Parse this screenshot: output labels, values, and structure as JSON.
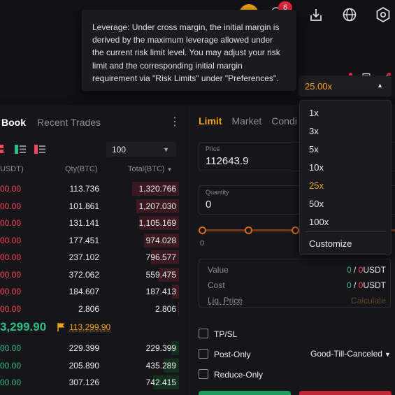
{
  "topbar": {
    "notification_count": "6",
    "icons": [
      "download-icon",
      "globe-icon",
      "settings-hexagon-icon"
    ]
  },
  "tooltip": {
    "text": "Leverage: Under cross margin, the initial margin is derived by the maximum leverage allowed under the current risk limit level. You may adjust your risk limit and the corresponding initial margin requirement via \"Risk Limits\" under \"Preferences\"."
  },
  "leverage": {
    "current": "25.00x",
    "options": [
      "1x",
      "3x",
      "5x",
      "10x",
      "25x",
      "50x",
      "100x"
    ],
    "selected": "25x",
    "customize": "Customize"
  },
  "orderbook": {
    "tab_book": "Book",
    "tab_trades": "Recent Trades",
    "depth": "100",
    "col_price": "USDT)",
    "col_qty": "Qty(BTC)",
    "col_total": "Total(BTC)",
    "asks": [
      {
        "price": "00.00",
        "qty": "113.736",
        "total": "1,320.766",
        "depth": 0.7
      },
      {
        "price": "00.00",
        "qty": "101.861",
        "total": "1,207.030",
        "depth": 0.64
      },
      {
        "price": "00.00",
        "qty": "131.141",
        "total": "1,105.169",
        "depth": 0.59
      },
      {
        "price": "00.00",
        "qty": "177.451",
        "total": "974.028",
        "depth": 0.52
      },
      {
        "price": "00.00",
        "qty": "237.102",
        "total": "796.577",
        "depth": 0.42
      },
      {
        "price": "00.00",
        "qty": "372.062",
        "total": "559.475",
        "depth": 0.3
      },
      {
        "price": "00.00",
        "qty": "184.607",
        "total": "187.413",
        "depth": 0.1
      },
      {
        "price": "00.00",
        "qty": "2.806",
        "total": "2.806",
        "depth": 0.01
      }
    ],
    "mid_price": "3,299.90",
    "mark_price": "113,299.90",
    "bids": [
      {
        "price": "00.00",
        "qty": "229.399",
        "total": "229.399",
        "depth": 0.12
      },
      {
        "price": "00.00",
        "qty": "205.890",
        "total": "435.289",
        "depth": 0.23
      },
      {
        "price": "00.00",
        "qty": "307.126",
        "total": "742.415",
        "depth": 0.39
      }
    ]
  },
  "order_form": {
    "tabs": [
      "Limit",
      "Market",
      "Condi"
    ],
    "price_label": "Price",
    "price_value": "112643.9",
    "qty_label": "Quantity",
    "qty_value": "0",
    "slider_start": "0",
    "value_label": "Value",
    "value_green": "0",
    "value_sep": " / ",
    "value_red": "0",
    "value_unit": "USDT",
    "cost_label": "Cost",
    "cost_green": "0",
    "cost_red": "0",
    "cost_unit": "USDT",
    "liq_label": "Liq. Price",
    "liq_value": "Calculate",
    "tpsl": "TP/SL",
    "post_only": "Post-Only",
    "reduce_only": "Reduce-Only",
    "time_in_force": "Good-Till-Canceled"
  },
  "colors": {
    "accent": "#f0a315",
    "buy": "#2ebd85",
    "sell": "#f6465d",
    "background": "#16161a"
  }
}
